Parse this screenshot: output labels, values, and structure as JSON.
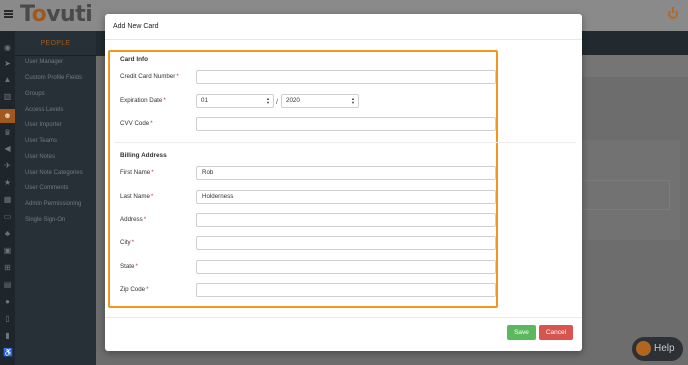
{
  "app": {
    "logo_text_pre": "T",
    "logo_text_o": "o",
    "logo_text_post": "vuti"
  },
  "sidebar": {
    "heading": "PEOPLE",
    "items": [
      {
        "label": "User Manager"
      },
      {
        "label": "Custom Profile Fields"
      },
      {
        "label": "Groups"
      },
      {
        "label": "Access Levels"
      },
      {
        "label": "User Importer"
      },
      {
        "label": "User Teams"
      },
      {
        "label": "User Notes"
      },
      {
        "label": "User Note Categories"
      },
      {
        "label": "User Comments"
      },
      {
        "label": "Admin Permissioning"
      },
      {
        "label": "Single Sign-On"
      }
    ]
  },
  "help": {
    "label": "Help"
  },
  "modal": {
    "title": "Add New Card",
    "card_info": {
      "heading": "Card Info",
      "card_number_label": "Credit Card Number",
      "card_number_value": "",
      "expiration_label": "Expiration Date",
      "exp_month": "01",
      "exp_separator": "/",
      "exp_year": "2020",
      "cvv_label": "CVV Code",
      "cvv_value": ""
    },
    "billing": {
      "heading": "Billing Address",
      "first_name_label": "First Name",
      "first_name_value": "Rob",
      "last_name_label": "Last Name",
      "last_name_value": "Holderness",
      "address_label": "Address",
      "address_value": "",
      "city_label": "City",
      "city_value": "",
      "state_label": "State",
      "state_value": "",
      "zip_label": "Zip Code",
      "zip_value": ""
    },
    "required_mark": "*",
    "save_label": "Save",
    "cancel_label": "Cancel"
  },
  "colors": {
    "accent": "#a0581c",
    "highlight_frame": "#f2961e",
    "save": "#5cb85c",
    "cancel": "#d9534f"
  }
}
